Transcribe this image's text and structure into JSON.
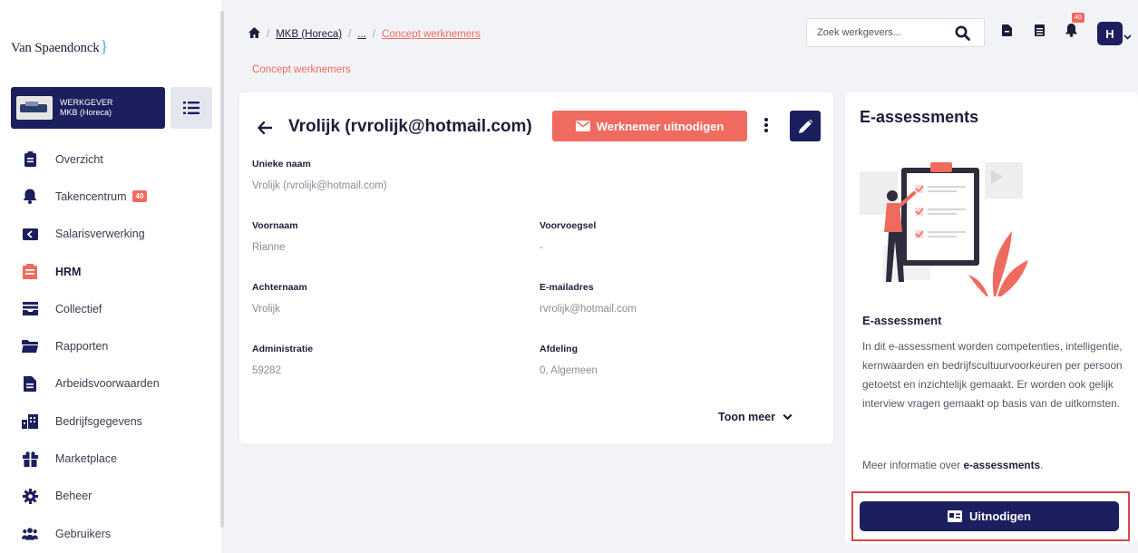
{
  "brand": {
    "logo_text": "Van Spaendonck",
    "logo_bracket": "}"
  },
  "employer": {
    "label": "WERKGEVER",
    "name": "MKB (Horeca)"
  },
  "nav": [
    {
      "label": "Overzicht",
      "icon": "clipboard-icon"
    },
    {
      "label": "Takencentrum",
      "icon": "bell-icon",
      "badge": "40"
    },
    {
      "label": "Salarisverwerking",
      "icon": "money-icon"
    },
    {
      "label": "HRM",
      "icon": "hrm-icon",
      "active": true
    },
    {
      "label": "Collectief",
      "icon": "inbox-icon"
    },
    {
      "label": "Rapporten",
      "icon": "folder-icon"
    },
    {
      "label": "Arbeidsvoorwaarden",
      "icon": "document-icon"
    },
    {
      "label": "Bedrijfsgegevens",
      "icon": "building-icon"
    },
    {
      "label": "Marketplace",
      "icon": "gift-icon"
    },
    {
      "label": "Beheer",
      "icon": "gear-icon"
    },
    {
      "label": "Gebruikers",
      "icon": "users-icon"
    }
  ],
  "breadcrumb": {
    "sep": "/",
    "level1": "MKB (Horeca)",
    "ellipsis": "...",
    "current": "Concept werknemers"
  },
  "page_subtitle": "Concept werknemers",
  "search": {
    "placeholder": "Zoek werkgevers..."
  },
  "notifications": {
    "count": "40"
  },
  "user": {
    "initial": "H"
  },
  "employee": {
    "title": "Vrolijk (rvrolijk@hotmail.com)",
    "invite_label": "Werknemer uitnodigen",
    "show_more": "Toon meer",
    "fields": {
      "unique_name": {
        "label": "Unieke naam",
        "value": "Vrolijk (rvrolijk@hotmail.com)"
      },
      "first_name": {
        "label": "Voornaam",
        "value": "Rianne"
      },
      "prefix": {
        "label": "Voorvoegsel",
        "value": "-"
      },
      "last_name": {
        "label": "Achternaam",
        "value": "Vrolijk"
      },
      "email": {
        "label": "E-mailadres",
        "value": "rvrolijk@hotmail.com"
      },
      "administration": {
        "label": "Administratie",
        "value": "59282"
      },
      "department": {
        "label": "Afdeling",
        "value": "0, Algemeen"
      }
    }
  },
  "assessment": {
    "title": "E-assessments",
    "heading": "E-assessment",
    "text": "In dit e-assessment worden competenties, intelligentie, kernwaarden en bedrijfscultuurvoorkeuren per persoon getoetst en inzichtelijk gemaakt. Er worden ook gelijk interview vragen gemaakt op basis van de uitkomsten.",
    "more_prefix": "Meer informatie over ",
    "more_link": "e-assessments",
    "more_suffix": ".",
    "button_label": "Uitnodigen"
  },
  "colors": {
    "navy": "#1b1f5e",
    "coral": "#ef6a5f",
    "highlight": "#d44a47"
  }
}
